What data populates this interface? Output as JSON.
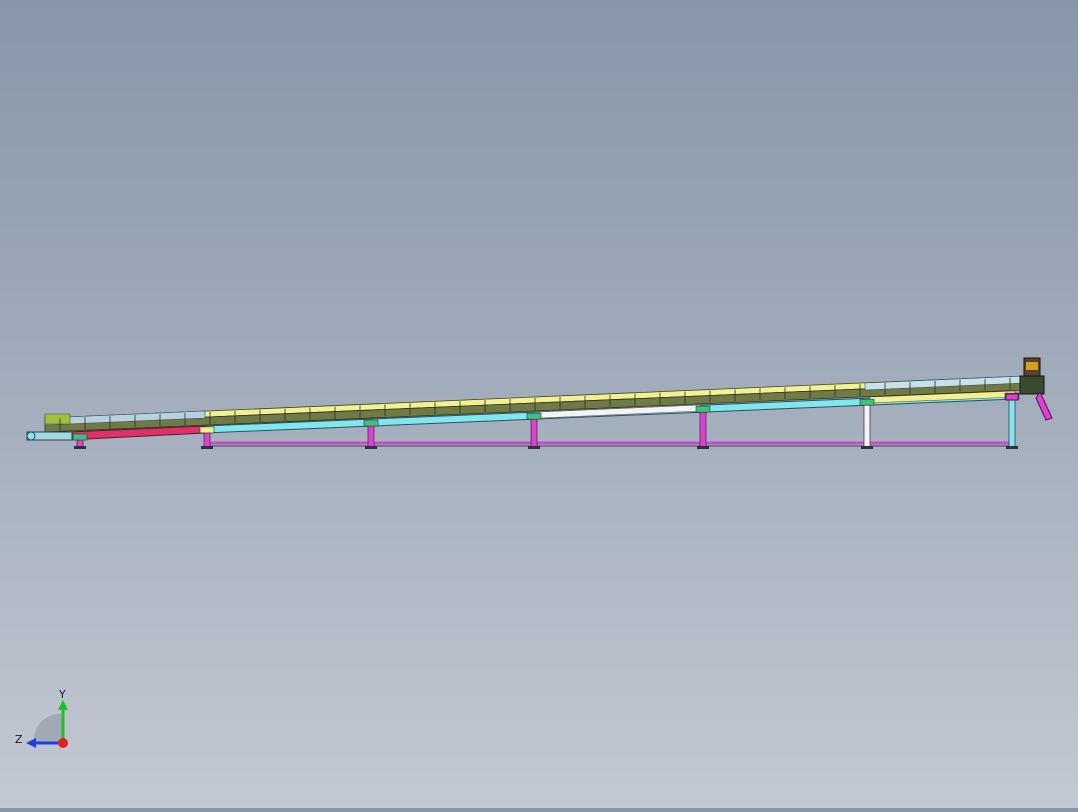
{
  "viewport": {
    "background_top": "#8796a9",
    "background_bottom": "#c3c9d3"
  },
  "model": {
    "description_icon": "conveyor-assembly-model",
    "colors": {
      "frame_cyan": "#7fe8ef",
      "leg_magenta": "#e040d0",
      "rail_yellow": "#f2f090",
      "belt_olive": "#6f7a45",
      "belt_grey": "#8a9aa0",
      "red_section": "#e0306a",
      "white_section": "#f4f4f4",
      "green_accent": "#40c080",
      "motor": "#5a4030"
    }
  },
  "triad": {
    "y_label": "Y",
    "z_label": "Z",
    "y_color": "#20c020",
    "z_color": "#2040e0",
    "x_color": "#e02020"
  }
}
